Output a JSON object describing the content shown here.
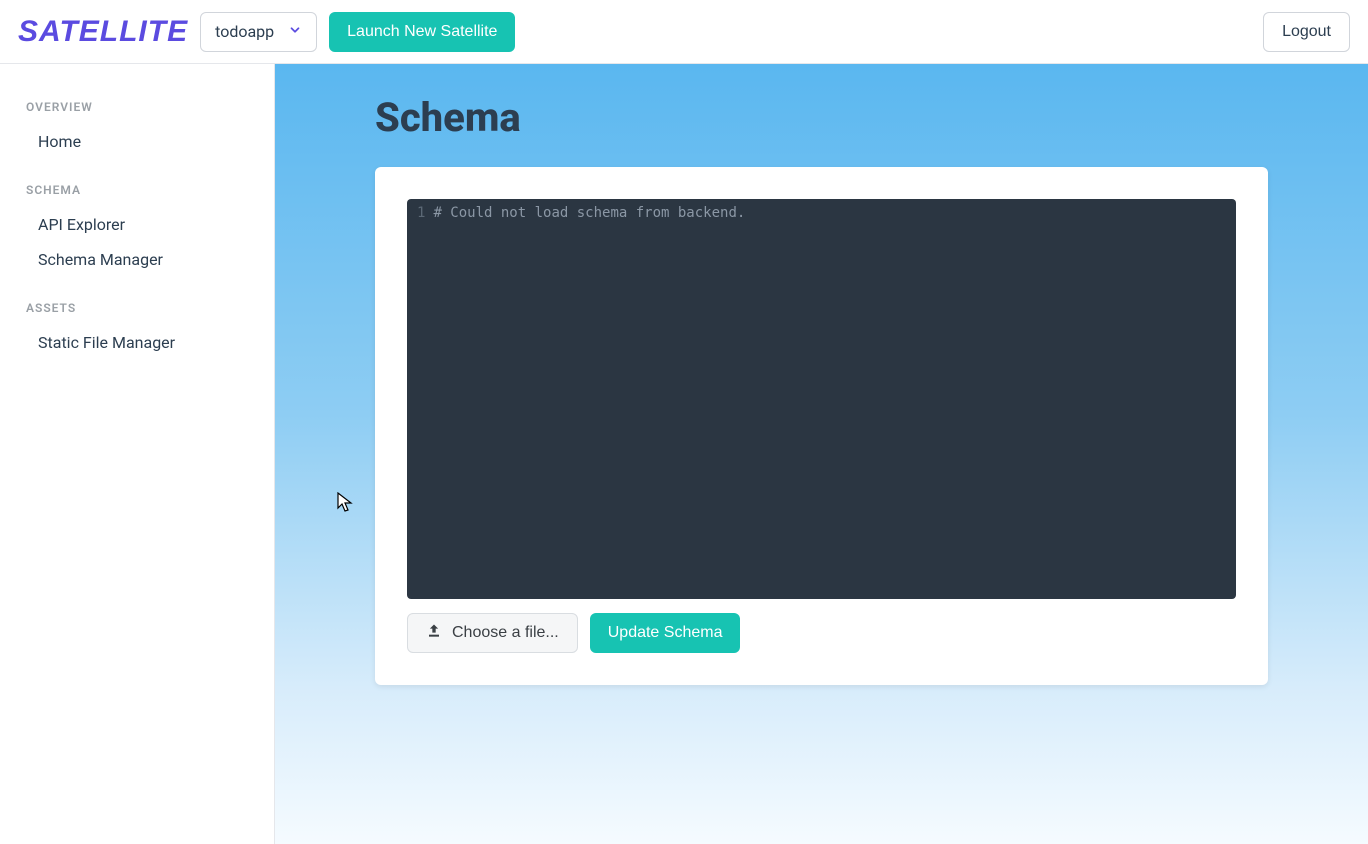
{
  "header": {
    "logo": "SATELLITE",
    "project_selected": "todoapp",
    "launch_label": "Launch New Satellite",
    "logout_label": "Logout"
  },
  "sidebar": {
    "sections": [
      {
        "title": "OVERVIEW",
        "items": [
          "Home"
        ]
      },
      {
        "title": "SCHEMA",
        "items": [
          "API Explorer",
          "Schema Manager"
        ]
      },
      {
        "title": "ASSETS",
        "items": [
          "Static File Manager"
        ]
      }
    ]
  },
  "main": {
    "title": "Schema",
    "editor": {
      "line_no": "1",
      "line_text": "# Could not load schema from backend."
    },
    "choose_file_label": "Choose a file...",
    "update_label": "Update Schema"
  }
}
